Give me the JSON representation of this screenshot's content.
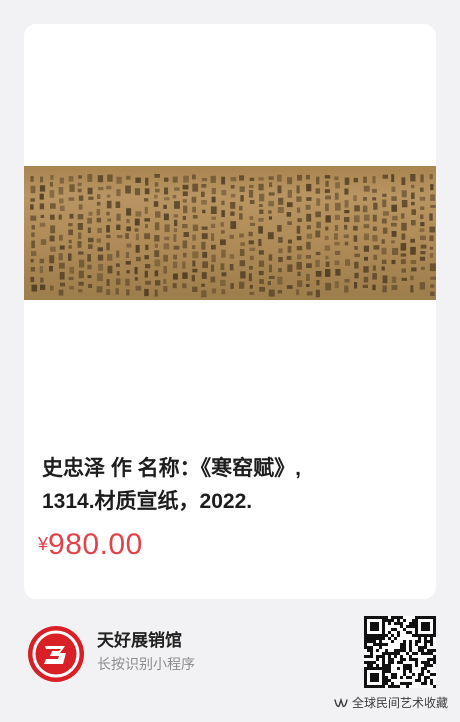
{
  "product": {
    "title_line1": "史忠泽 作 名称：《寒窑赋》,",
    "title_line2": "1314.材质宣纸，2022.",
    "currency_symbol": "¥",
    "price": "980.00",
    "image_icon": "calligraphy-scroll"
  },
  "footer": {
    "shop_name": "天好展销馆",
    "hint": "长按识别小程序",
    "logo_icon": "shop-logo-3",
    "qr_icon": "qr-code"
  },
  "watermark": {
    "text": "全球民间艺术收藏",
    "icon": "wechat-channel-icon"
  },
  "colors": {
    "background": "#f2f2f4",
    "card": "#ffffff",
    "price": "#e2434a",
    "logo_red": "#d92027"
  }
}
